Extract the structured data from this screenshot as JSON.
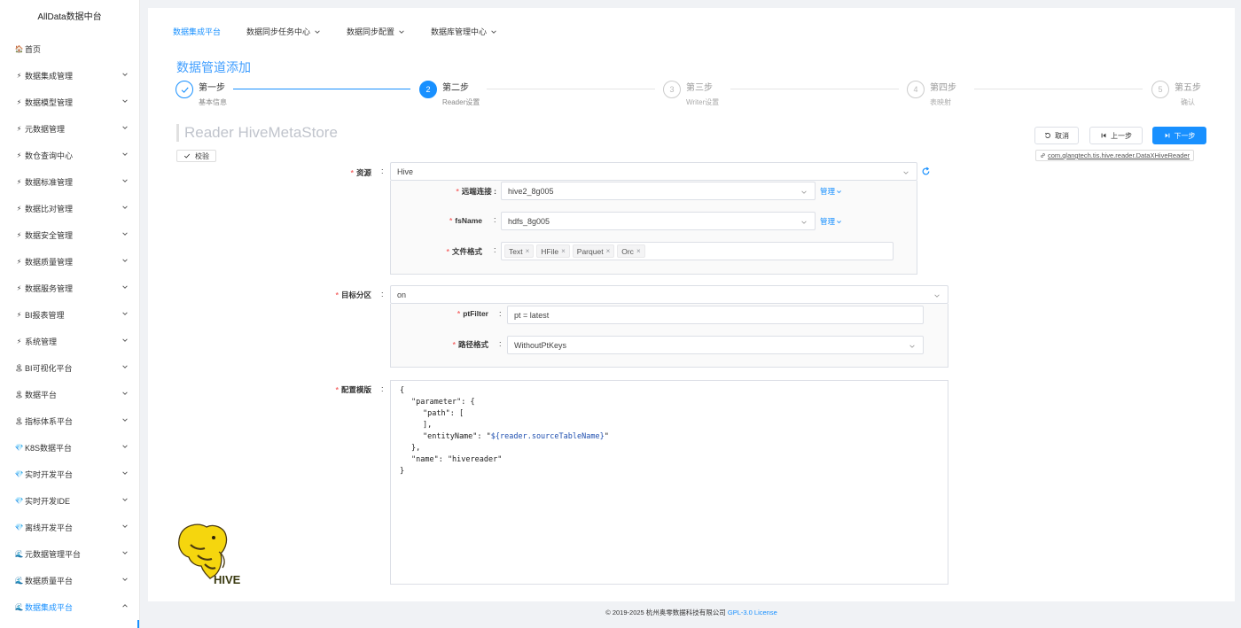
{
  "sidebar": {
    "title": "AllData数据中台",
    "items": [
      {
        "icon": "🏠",
        "icon_name": "home-icon",
        "label": "首页",
        "chevron": "none"
      },
      {
        "icon": "⚡",
        "icon_name": "lightning-icon",
        "label": "数据集成管理",
        "chevron": "down"
      },
      {
        "icon": "⚡",
        "icon_name": "lightning-icon",
        "label": "数据模型管理",
        "chevron": "down"
      },
      {
        "icon": "⚡",
        "icon_name": "lightning-icon",
        "label": "元数据管理",
        "chevron": "down"
      },
      {
        "icon": "⚡",
        "icon_name": "lightning-icon",
        "label": "数仓查询中心",
        "chevron": "down"
      },
      {
        "icon": "⚡",
        "icon_name": "lightning-icon",
        "label": "数据标准管理",
        "chevron": "down"
      },
      {
        "icon": "⚡",
        "icon_name": "lightning-icon",
        "label": "数据比对管理",
        "chevron": "down"
      },
      {
        "icon": "⚡",
        "icon_name": "lightning-icon",
        "label": "数据安全管理",
        "chevron": "down"
      },
      {
        "icon": "⚡",
        "icon_name": "lightning-icon",
        "label": "数据质量管理",
        "chevron": "down"
      },
      {
        "icon": "⚡",
        "icon_name": "lightning-icon",
        "label": "数据服务管理",
        "chevron": "down"
      },
      {
        "icon": "⚡",
        "icon_name": "lightning-icon",
        "label": "BI报表管理",
        "chevron": "down"
      },
      {
        "icon": "⚡",
        "icon_name": "lightning-icon",
        "label": "系统管理",
        "chevron": "down"
      },
      {
        "icon": "🏝",
        "icon_name": "island-icon",
        "label": "BI可视化平台",
        "chevron": "down"
      },
      {
        "icon": "🏝",
        "icon_name": "island-icon",
        "label": "数据平台",
        "chevron": "down"
      },
      {
        "icon": "🏝",
        "icon_name": "island-icon",
        "label": "指标体系平台",
        "chevron": "down"
      },
      {
        "icon": "💎",
        "icon_name": "diamond-icon",
        "label": "K8S数据平台",
        "chevron": "down"
      },
      {
        "icon": "💎",
        "icon_name": "diamond-icon",
        "label": "实时开发平台",
        "chevron": "down"
      },
      {
        "icon": "💎",
        "icon_name": "diamond-icon",
        "label": "实时开发IDE",
        "chevron": "down"
      },
      {
        "icon": "💎",
        "icon_name": "diamond-icon",
        "label": "离线开发平台",
        "chevron": "down"
      },
      {
        "icon": "🌊",
        "icon_name": "wave-icon",
        "label": "元数据管理平台",
        "chevron": "down"
      },
      {
        "icon": "🌊",
        "icon_name": "wave-icon",
        "label": "数据质量平台",
        "chevron": "down"
      },
      {
        "icon": "🌊",
        "icon_name": "wave-icon",
        "label": "数据集成平台",
        "chevron": "up",
        "active": true
      }
    ]
  },
  "topnav": {
    "items": [
      {
        "label": "数据集成平台",
        "active": true,
        "dropdown": false
      },
      {
        "label": "数据同步任务中心",
        "dropdown": true
      },
      {
        "label": "数据同步配置",
        "dropdown": true
      },
      {
        "label": "数据库管理中心",
        "dropdown": true
      }
    ]
  },
  "page": {
    "title": "数据管道添加",
    "reader_title": "Reader HiveMetaStore",
    "check_label": "校验"
  },
  "steps": [
    {
      "num": "1",
      "title": "第一步",
      "desc": "基本信息",
      "status": "done"
    },
    {
      "num": "2",
      "title": "第二步",
      "desc": "Reader设置",
      "status": "current"
    },
    {
      "num": "3",
      "title": "第三步",
      "desc": "Writer设置",
      "status": "wait"
    },
    {
      "num": "4",
      "title": "第四步",
      "desc": "表映射",
      "status": "wait"
    },
    {
      "num": "5",
      "title": "第五步",
      "desc": "确认",
      "status": "wait"
    }
  ],
  "actions": {
    "cancel": "取消",
    "prev": "上一步",
    "next": "下一步",
    "plugin": "com.qlangtech.tis.hive.reader.DataXHiveReader"
  },
  "form": {
    "colon": ":",
    "source": {
      "label": "资源",
      "value": "Hive"
    },
    "remote": {
      "label": "远端连接",
      "value": "hive2_8g005",
      "manage": "管理"
    },
    "fsname": {
      "label": "fsName",
      "value": "hdfs_8g005",
      "manage": "管理"
    },
    "format": {
      "label": "文件格式",
      "tags": [
        "Text",
        "HFile",
        "Parquet",
        "Orc"
      ]
    },
    "partition": {
      "label": "目标分区",
      "value": "on"
    },
    "ptfilter": {
      "label": "ptFilter",
      "value": "pt = latest"
    },
    "pathformat": {
      "label": "路径格式",
      "value": "WithoutPtKeys"
    },
    "template": {
      "label": "配置模版"
    }
  },
  "template_code": [
    {
      "indent": 0,
      "pre": "{",
      "var": "",
      "post": ""
    },
    {
      "indent": 1,
      "pre": "\"parameter\": {",
      "var": "",
      "post": ""
    },
    {
      "indent": 2,
      "pre": "\"path\": [",
      "var": "",
      "post": ""
    },
    {
      "indent": 2,
      "pre": "],",
      "var": "",
      "post": ""
    },
    {
      "indent": 2,
      "pre": "\"entityName\": \"",
      "var": "${reader.sourceTableName}",
      "post": "\""
    },
    {
      "indent": 1,
      "pre": "},",
      "var": "",
      "post": ""
    },
    {
      "indent": 1,
      "pre": "\"name\": \"hivereader\"",
      "var": "",
      "post": ""
    },
    {
      "indent": 0,
      "pre": "}",
      "var": "",
      "post": ""
    }
  ],
  "logo": {
    "text": "HIVE"
  },
  "footer": {
    "copyright": "© 2019-2025 杭州奥零数据科技有限公司 ",
    "license": "GPL-3.0 License"
  },
  "colors": {
    "primary": "#1890ff",
    "required": "#f56c6c",
    "hive_yellow": "#f5d60e"
  }
}
